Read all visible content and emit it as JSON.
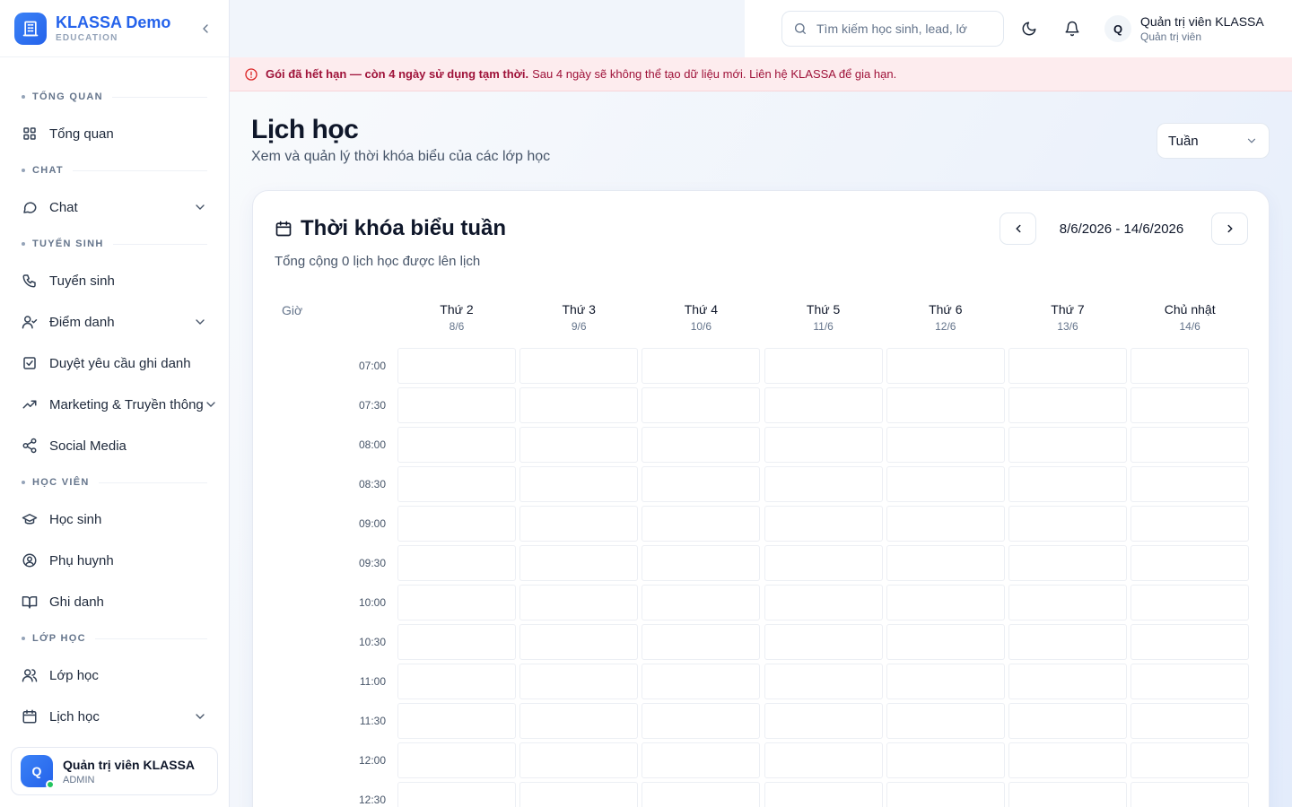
{
  "sidebar": {
    "brand_name": "KLASSA Demo",
    "brand_sub": "EDUCATION",
    "sections": [
      {
        "title": "TỔNG QUAN",
        "items": [
          {
            "label": "Tổng quan",
            "icon": "grid-icon",
            "chevron": false
          }
        ]
      },
      {
        "title": "CHAT",
        "items": [
          {
            "label": "Chat",
            "icon": "chat-bubble-icon",
            "chevron": true
          }
        ]
      },
      {
        "title": "TUYỂN SINH",
        "items": [
          {
            "label": "Tuyển sinh",
            "icon": "phone-icon",
            "chevron": false
          },
          {
            "label": "Điểm danh",
            "icon": "user-check-icon",
            "chevron": true
          },
          {
            "label": "Duyệt yêu cầu ghi danh",
            "icon": "check-square-icon",
            "chevron": false
          },
          {
            "label": "Marketing & Truyền thông",
            "icon": "trending-up-icon",
            "chevron": true
          },
          {
            "label": "Social Media",
            "icon": "share-icon",
            "chevron": false
          }
        ]
      },
      {
        "title": "HỌC VIÊN",
        "items": [
          {
            "label": "Học sinh",
            "icon": "graduation-cap-icon",
            "chevron": false
          },
          {
            "label": "Phụ huynh",
            "icon": "user-circle-icon",
            "chevron": false
          },
          {
            "label": "Ghi danh",
            "icon": "book-open-icon",
            "chevron": false
          }
        ]
      },
      {
        "title": "LỚP HỌC",
        "items": [
          {
            "label": "Lớp học",
            "icon": "users-icon",
            "chevron": false
          },
          {
            "label": "Lịch học",
            "icon": "calendar-icon",
            "chevron": true
          }
        ]
      }
    ],
    "user": {
      "initial": "Q",
      "name": "Quản trị viên KLASSA",
      "role": "ADMIN"
    }
  },
  "topbar": {
    "search_placeholder": "Tìm kiếm học sinh, lead, lớ",
    "user_initial": "Q",
    "user_name": "Quản trị viên KLASSA",
    "user_role": "Quản trị viên"
  },
  "banner": {
    "strong": "Gói đã hết hạn — còn 4 ngày sử dụng tạm thời.",
    "text": "Sau 4 ngày sẽ không thể tạo dữ liệu mới. Liên hệ KLASSA để gia hạn."
  },
  "page": {
    "title": "Lịch học",
    "subtitle": "Xem và quản lý thời khóa biểu của các lớp học",
    "view_select": "Tuần"
  },
  "schedule": {
    "title": "Thời khóa biểu tuần",
    "total": "Tổng cộng 0 lịch học được lên lịch",
    "range": "8/6/2026 - 14/6/2026",
    "time_header": "Giờ",
    "days": [
      {
        "name": "Thứ 2",
        "date": "8/6"
      },
      {
        "name": "Thứ 3",
        "date": "9/6"
      },
      {
        "name": "Thứ 4",
        "date": "10/6"
      },
      {
        "name": "Thứ 5",
        "date": "11/6"
      },
      {
        "name": "Thứ 6",
        "date": "12/6"
      },
      {
        "name": "Thứ 7",
        "date": "13/6"
      },
      {
        "name": "Chủ nhật",
        "date": "14/6"
      }
    ],
    "times": [
      "07:00",
      "07:30",
      "08:00",
      "08:30",
      "09:00",
      "09:30",
      "10:00",
      "10:30",
      "11:00",
      "11:30",
      "12:00",
      "12:30"
    ]
  },
  "colors": {
    "accent": "#2563eb",
    "banner_bg": "#fdecee",
    "banner_text": "#9f1239",
    "online": "#22c55e"
  }
}
